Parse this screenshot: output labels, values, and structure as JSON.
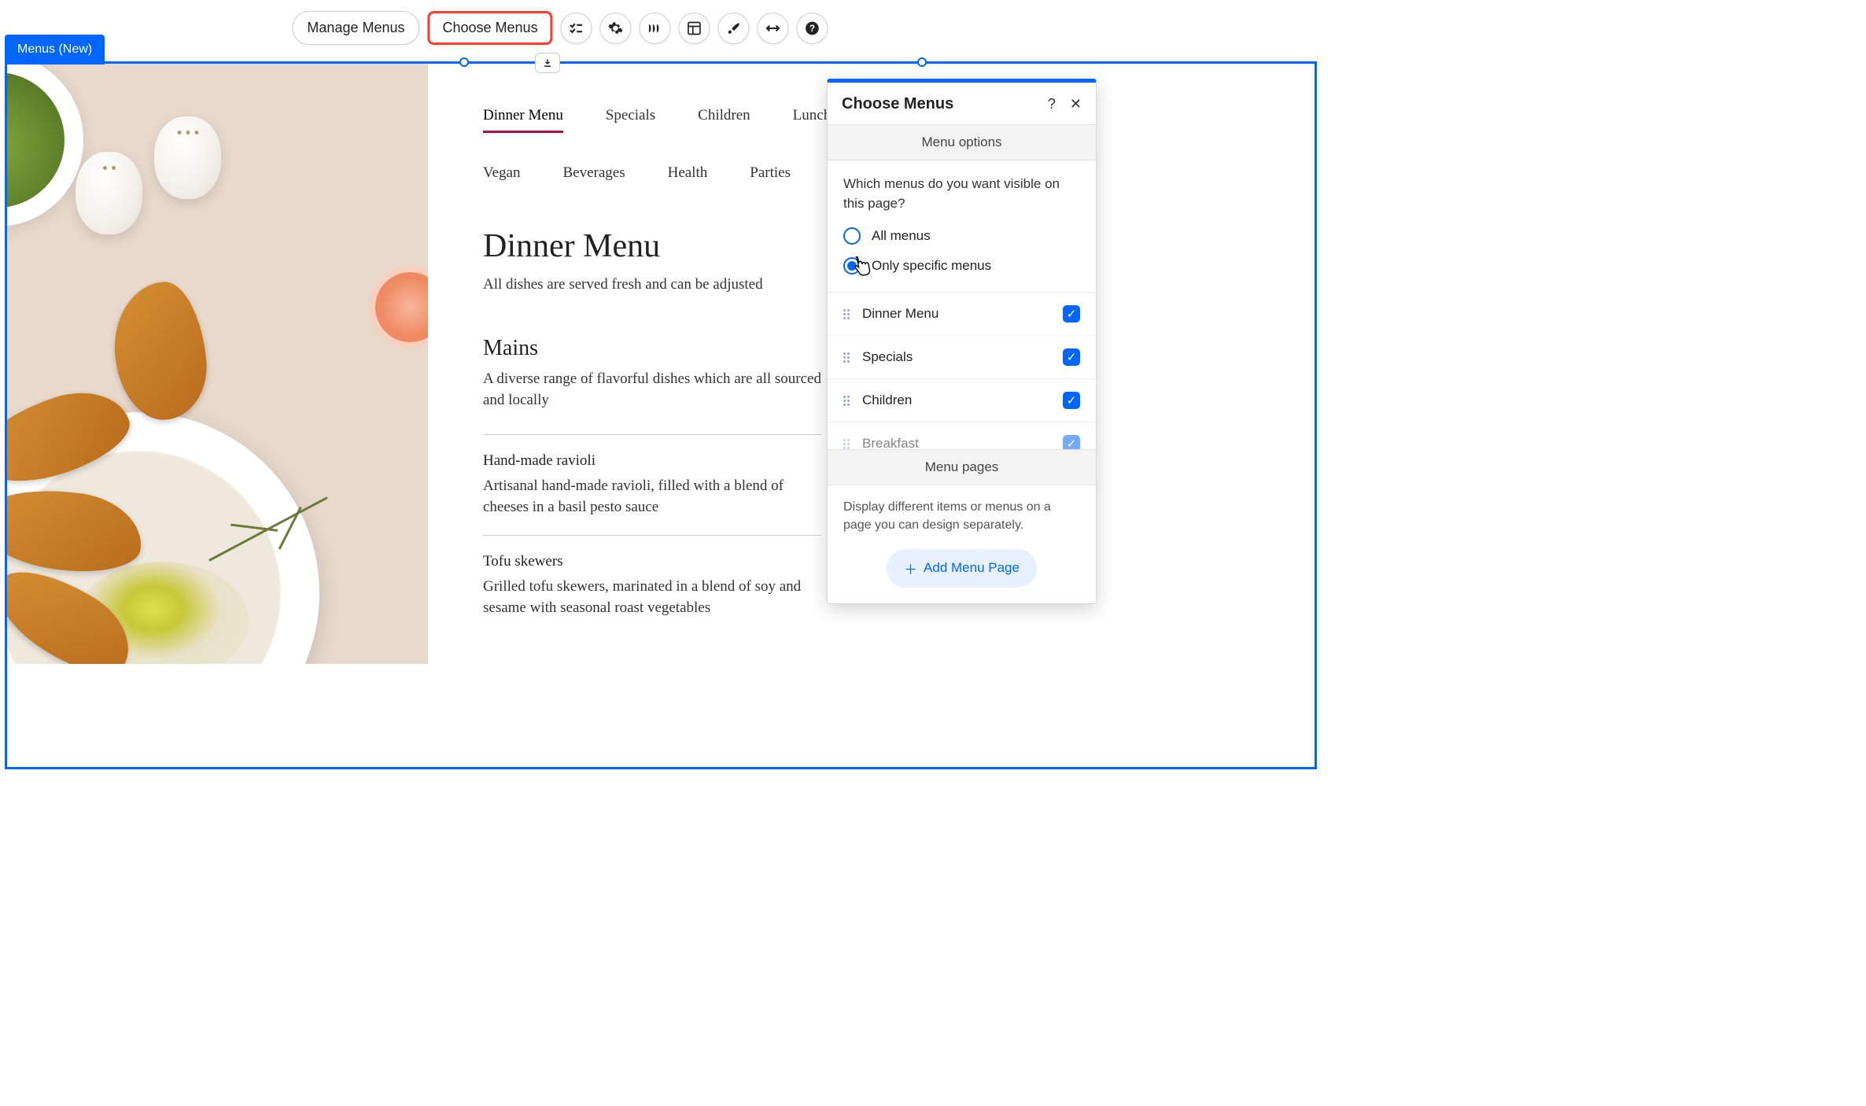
{
  "toolbar": {
    "manage_label": "Manage Menus",
    "choose_label": "Choose Menus"
  },
  "selection_tag": "Menus (New)",
  "tabs": [
    "Dinner Menu",
    "Specials",
    "Children",
    "Lunch",
    "Vegan",
    "Beverages",
    "Health",
    "Parties"
  ],
  "active_tab_index": 0,
  "menu": {
    "title": "Dinner Menu",
    "subtitle": "All dishes are served fresh and can be adjusted",
    "section": {
      "title": "Mains",
      "subtitle": "A diverse range of flavorful dishes which are all sourced and locally"
    },
    "items": [
      {
        "name": "Hand-made ravioli",
        "desc": "Artisanal hand-made ravioli, filled with a blend of cheeses in a basil pesto sauce"
      },
      {
        "name": "Tofu skewers",
        "desc": "Grilled tofu skewers, marinated in a blend of soy and sesame with seasonal roast vegetables"
      }
    ]
  },
  "panel": {
    "title": "Choose Menus",
    "options_head": "Menu options",
    "question": "Which menus do you want visible on this page?",
    "radio_all": "All menus",
    "radio_specific": "Only specific menus",
    "menus": [
      {
        "label": "Dinner Menu",
        "checked": true
      },
      {
        "label": "Specials",
        "checked": true
      },
      {
        "label": "Children",
        "checked": true
      },
      {
        "label": "Breakfast",
        "checked": true
      }
    ],
    "pages_head": "Menu pages",
    "pages_desc": "Display different items or menus on a page you can design separately.",
    "add_label": "Add Menu Page"
  }
}
